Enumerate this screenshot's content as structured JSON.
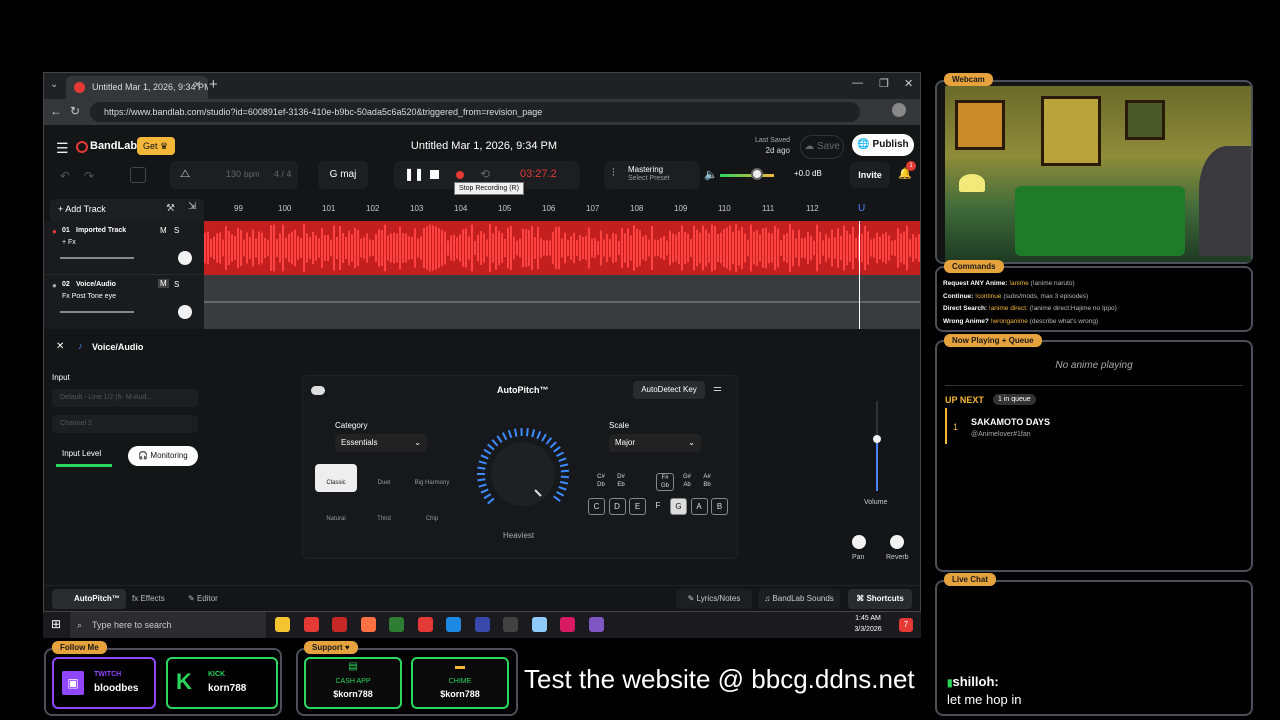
{
  "browser": {
    "tab_title": "Untitled Mar 1, 2026, 9:34 PM",
    "url": "https://www.bandlab.com/studio?id=600891ef-3136-410e-b9bc-50ada5c6a520&triggered_from=revision_page"
  },
  "bandlab": {
    "logo": "BandLab",
    "get_label": "Get",
    "project_title": "Untitled Mar 1, 2026, 9:34 PM",
    "last_saved_label": "Last Saved",
    "last_saved_value": "2d ago",
    "save_label": "Save",
    "publish_label": "Publish",
    "bpm_value": "130",
    "bpm_unit": "bpm",
    "time_sig": "4 / 4",
    "key": "G maj",
    "timer": "03:27.2",
    "tooltip": "Stop Recording (R)",
    "mastering_label": "Mastering",
    "mastering_sub": "Select Preset",
    "volume_db": "+0.0 dB",
    "invite_label": "Invite",
    "notif_count": "1",
    "add_track_label": "Add Track",
    "ruler": [
      "99",
      "100",
      "101",
      "102",
      "103",
      "104",
      "105",
      "106",
      "107",
      "108",
      "109",
      "110",
      "111",
      "112"
    ],
    "tracks": [
      {
        "num": "01",
        "name": "Imported Track",
        "fx": "+ Fx",
        "m": "M",
        "s": "S"
      },
      {
        "num": "02",
        "name": "Voice/Audio",
        "fx": "Fx Post Tone eye",
        "m": "M",
        "s": "S"
      }
    ],
    "panel_title": "Voice/Audio",
    "input_label": "Input",
    "input_device": "Default - Line 1/2 (6- M-Aud...",
    "input_channel": "Channel 2",
    "input_level_label": "Input Level",
    "monitoring_label": "Monitoring",
    "autopitch_title": "AutoPitch™",
    "autodetect_label": "AutoDetect Key",
    "category_label": "Category",
    "category_value": "Essentials",
    "presets": [
      "Classic",
      "Duet",
      "Big Harmony",
      "Natural",
      "Third",
      "Chip"
    ],
    "dial_label": "Heaviest",
    "scale_label": "Scale",
    "scale_value": "Major",
    "sharps": [
      "C#\nDb",
      "D#\nEb",
      "F#\nGb",
      "G#\nAb",
      "A#\nBb"
    ],
    "notes": [
      "C",
      "D",
      "E",
      "F",
      "G",
      "A",
      "B"
    ],
    "volume_label": "Volume",
    "pan_label": "Pan",
    "reverb_label": "Reverb",
    "bottom_tabs": [
      "AutoPitch™",
      "Effects",
      "Editor"
    ],
    "bottom_right": [
      "Lyrics/Notes",
      "BandLab Sounds",
      "Shortcuts"
    ]
  },
  "taskbar": {
    "search_placeholder": "Type here to search",
    "time": "1:45 AM",
    "date": "3/3/2026"
  },
  "overlay": {
    "webcam_label": "Webcam",
    "commands_label": "Commands",
    "commands": [
      {
        "k": "Request ANY Anime:",
        "c": "!anime",
        "d": "(!anime naruto)"
      },
      {
        "k": "Continue:",
        "c": "!continue",
        "d": "(subs/mods, max 3 episodes)"
      },
      {
        "k": "Direct Search:",
        "c": "!anime direct:",
        "d": "(!anime direct:Hajime no Ippo)"
      },
      {
        "k": "Wrong Anime?",
        "c": "!wronganime",
        "d": "(describe what's wrong)"
      }
    ],
    "now_playing_label": "Now Playing + Queue",
    "now_playing": "No anime playing",
    "up_next": "UP NEXT",
    "queue_count": "1 in queue",
    "queue": [
      {
        "n": "1",
        "title": "SAKAMOTO DAYS",
        "user": "@Animelover#1fan"
      }
    ],
    "live_chat_label": "Live Chat",
    "chat_user": "shilloh:",
    "chat_msg": "let me hop in",
    "follow_label": "Follow Me",
    "twitch_label": "TWITCH",
    "twitch_user": "bloodbes",
    "kick_label": "KICK",
    "kick_user": "korn788",
    "support_label": "Support",
    "cashapp_label": "CASH APP",
    "cashapp_user": "$korn788",
    "chime_label": "CHIME",
    "chime_user": "$korn788",
    "website": "Test the website @ bbcg.ddns.net"
  },
  "colors": {
    "accent": "#e53935",
    "brand_gold": "#f4b73a",
    "green": "#2bd65c",
    "panel_border": "#4a4f58"
  }
}
